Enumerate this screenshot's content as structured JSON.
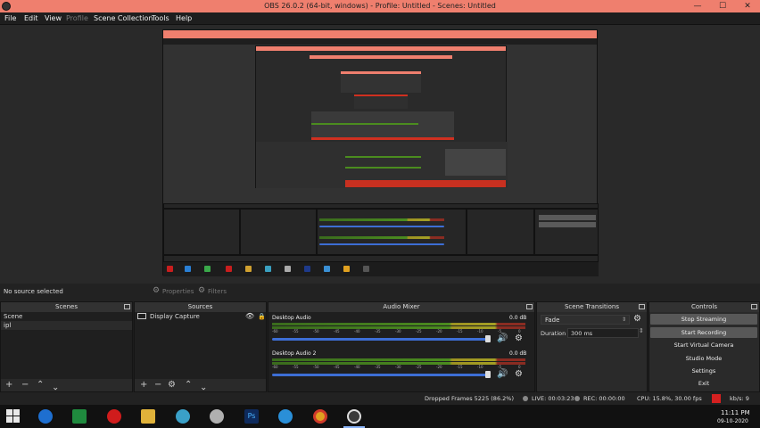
{
  "window": {
    "title": "OBS 26.0.2 (64-bit, windows) - Profile: Untitled - Scenes: Untitled",
    "minimize": "—",
    "maximize": "☐",
    "close": "✕"
  },
  "menu": [
    "File",
    "Edit",
    "View",
    "Profile",
    "Scene Collection",
    "Tools",
    "Help"
  ],
  "source_status": "No source selected",
  "properties_label": "Properties",
  "filters_label": "Filters",
  "scenes": {
    "title": "Scenes",
    "items": [
      "Scene",
      "ipl"
    ]
  },
  "sources": {
    "title": "Sources",
    "items": [
      "Display Capture"
    ]
  },
  "audio_mixer": {
    "title": "Audio Mixer",
    "channels": [
      {
        "name": "Desktop Audio",
        "db": "0.0 dB",
        "level": 0.8
      },
      {
        "name": "Desktop Audio 2",
        "db": "0.0 dB",
        "level": 0.76
      }
    ],
    "ticks": [
      "-60",
      "-55",
      "-50",
      "-45",
      "-40",
      "-35",
      "-30",
      "-25",
      "-20",
      "-15",
      "-10",
      "-5",
      "0"
    ]
  },
  "scene_transitions": {
    "title": "Scene Transitions",
    "transition": "Fade",
    "duration_label": "Duration",
    "duration_value": "300 ms"
  },
  "controls": {
    "title": "Controls",
    "buttons": [
      "Stop Streaming",
      "Start Recording",
      "Start Virtual Camera",
      "Studio Mode",
      "Settings",
      "Exit"
    ]
  },
  "stats": {
    "dropped_frames": "Dropped Frames 5225 (86.2%)",
    "live": "LIVE: 00:03:23",
    "rec": "REC: 00:00:00",
    "cpu": "CPU: 15.8%, 30.00 fps",
    "kbps": "kb/s: 9"
  },
  "taskbar": {
    "time": "11:11 PM",
    "date": "09-10-2020"
  },
  "colors": {
    "titlebar": "#ef7f6e",
    "accent_red": "#d42020",
    "slider_blue": "#3d6ed5"
  }
}
